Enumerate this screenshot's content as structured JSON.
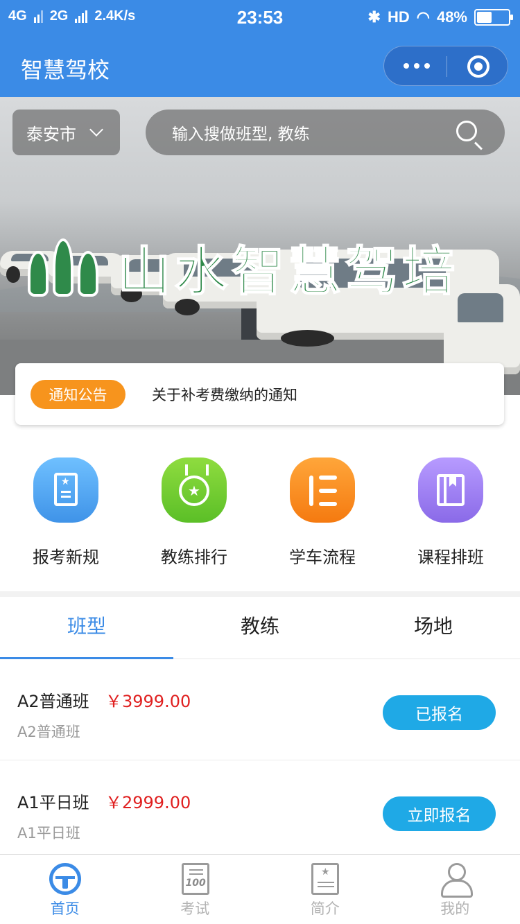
{
  "status_bar": {
    "network1": "4G",
    "network2": "2G",
    "speed": "2.4K/s",
    "time": "23:53",
    "bluetooth": "bluetooth-icon",
    "hd": "HD",
    "wifi": "wifi-icon",
    "battery": "48%",
    "battery_level": 0.48
  },
  "header": {
    "title": "智慧驾校",
    "more_icon": "more-dots-icon",
    "close_icon": "target-circle-icon"
  },
  "banner": {
    "city": "泰安市",
    "search_placeholder": "输入搜做班型, 教练",
    "logo_text": "山水智慧驾培"
  },
  "notice": {
    "tag": "通知公告",
    "text": "关于补考费缴纳的通知"
  },
  "quick_entries": [
    {
      "label": "报考新规",
      "icon": "notebook-icon",
      "color": "#4aa6f0"
    },
    {
      "label": "教练排行",
      "icon": "medal-icon",
      "color": "#6dc93a"
    },
    {
      "label": "学车流程",
      "icon": "list-icon",
      "color": "#f98b1c"
    },
    {
      "label": "课程排班",
      "icon": "bookmark-icon",
      "color": "#9c7ef0"
    }
  ],
  "tabs": [
    {
      "label": "班型",
      "active": true
    },
    {
      "label": "教练",
      "active": false
    },
    {
      "label": "场地",
      "active": false
    }
  ],
  "classes": [
    {
      "name": "A2普通班",
      "price": "￥3999.00",
      "subtitle": "A2普通班",
      "button": "已报名"
    },
    {
      "name": "A1平日班",
      "price": "￥2999.00",
      "subtitle": "A1平日班",
      "button": "立即报名"
    }
  ],
  "bottom_nav": [
    {
      "label": "首页",
      "icon": "steering-wheel-icon",
      "active": true
    },
    {
      "label": "考试",
      "icon": "exam-paper-icon",
      "active": false
    },
    {
      "label": "简介",
      "icon": "intro-doc-icon",
      "active": false
    },
    {
      "label": "我的",
      "icon": "person-icon",
      "active": false
    }
  ],
  "colors": {
    "primary": "#3b8be6",
    "notice_tag": "#f7941d",
    "price": "#e02020",
    "button": "#1fa9e6"
  }
}
